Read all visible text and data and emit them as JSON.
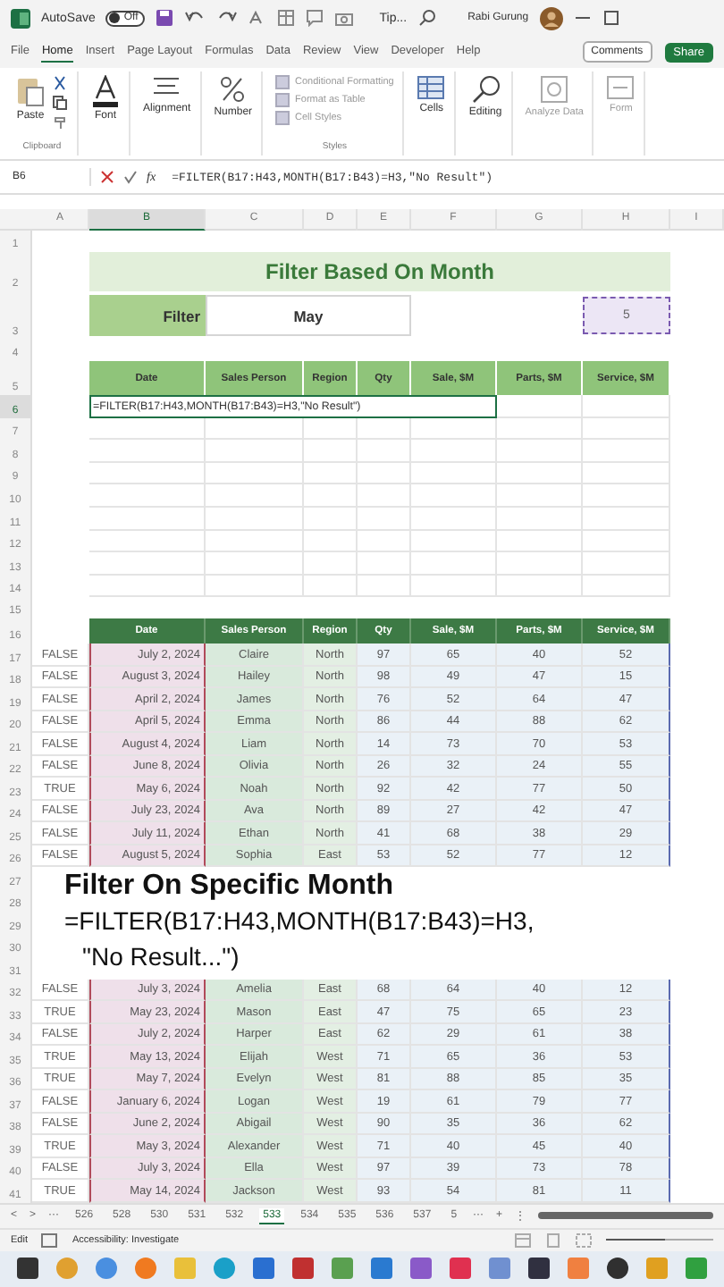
{
  "title_bar": {
    "autosave": "AutoSave",
    "autosave_state": "Off",
    "autosave_on": false,
    "document": "Tip...",
    "user": "Rabi Gurung"
  },
  "ribbon_tabs": [
    {
      "label": "File",
      "selected": false
    },
    {
      "label": "Home",
      "selected": true
    },
    {
      "label": "Insert",
      "selected": false
    },
    {
      "label": "Page Layout",
      "selected": false
    },
    {
      "label": "Formulas",
      "selected": false
    },
    {
      "label": "Data",
      "selected": false
    },
    {
      "label": "Review",
      "selected": false
    },
    {
      "label": "View",
      "selected": false
    },
    {
      "label": "Developer",
      "selected": false
    },
    {
      "label": "Help",
      "selected": false
    }
  ],
  "ribbon_buttons": {
    "comments": "Comments",
    "share": "Share"
  },
  "ribbon": {
    "paste": "Paste",
    "clipboard": "Clipboard",
    "font": "Font",
    "alignment": "Alignment",
    "number": "Number",
    "styles_items": [
      "Conditional Formatting",
      "Format as Table",
      "Cell Styles"
    ],
    "styles": "Styles",
    "cells": "Cells",
    "editing": "Editing",
    "analyze": "Analyze Data",
    "form": "Form"
  },
  "formula_bar": {
    "name_box": "B6",
    "fx": "fx",
    "formula": "=FILTER(B17:H43,MONTH(B17:B43)=H3,\"No Result\")"
  },
  "column_headers": [
    {
      "label": "A",
      "selected": false
    },
    {
      "label": "B",
      "selected": true
    },
    {
      "label": "C",
      "selected": false
    },
    {
      "label": "D",
      "selected": false
    },
    {
      "label": "E",
      "selected": false
    },
    {
      "label": "F",
      "selected": false
    },
    {
      "label": "G",
      "selected": false
    },
    {
      "label": "H",
      "selected": false
    },
    {
      "label": "I",
      "selected": false
    }
  ],
  "top_rows": [
    {
      "n": "1",
      "kind": "blank",
      "selected": false
    },
    {
      "n": "2",
      "kind": "title",
      "selected": false,
      "text": "Filter Based On Month"
    },
    {
      "n": "3",
      "kind": "filter",
      "selected": false,
      "label": "Filter",
      "value": "May",
      "month": "5"
    },
    {
      "n": "4",
      "kind": "blank",
      "selected": false
    },
    {
      "n": "5",
      "kind": "header",
      "selected": false,
      "cells": [
        "Date",
        "Sales Person",
        "Region",
        "Qty",
        "Sale, $M",
        "Parts, $M",
        "Service, $M"
      ]
    },
    {
      "n": "6",
      "kind": "editing",
      "selected": true,
      "text": "=FILTER(B17:H43,MONTH(B17:B43)=H3,\"No Result\")"
    },
    {
      "n": "7",
      "kind": "table_blank",
      "selected": false
    },
    {
      "n": "8",
      "kind": "table_blank",
      "selected": false
    },
    {
      "n": "9",
      "kind": "table_blank",
      "selected": false
    },
    {
      "n": "10",
      "kind": "table_blank",
      "selected": false
    },
    {
      "n": "11",
      "kind": "table_blank",
      "selected": false
    },
    {
      "n": "12",
      "kind": "table_blank",
      "selected": false
    },
    {
      "n": "13",
      "kind": "table_blank",
      "selected": false
    },
    {
      "n": "14",
      "kind": "table_blank",
      "selected": false
    },
    {
      "n": "15",
      "kind": "blank",
      "selected": false
    }
  ],
  "data_table": {
    "header": {
      "n": "16",
      "cells": [
        "Date",
        "Sales Person",
        "Region",
        "Qty",
        "Sale, $M",
        "Parts, $M",
        "Service, $M"
      ]
    },
    "rows": [
      {
        "n": "17",
        "cells": [
          "FALSE",
          "July 2, 2024",
          "Claire",
          "North",
          "97",
          "65",
          "40",
          "52"
        ]
      },
      {
        "n": "18",
        "cells": [
          "FALSE",
          "August 3, 2024",
          "Hailey",
          "North",
          "98",
          "49",
          "47",
          "15"
        ]
      },
      {
        "n": "19",
        "cells": [
          "FALSE",
          "April 2, 2024",
          "James",
          "North",
          "76",
          "52",
          "64",
          "47"
        ]
      },
      {
        "n": "20",
        "cells": [
          "FALSE",
          "April 5, 2024",
          "Emma",
          "North",
          "86",
          "44",
          "88",
          "62"
        ]
      },
      {
        "n": "21",
        "cells": [
          "FALSE",
          "August 4, 2024",
          "Liam",
          "North",
          "14",
          "73",
          "70",
          "53"
        ]
      },
      {
        "n": "22",
        "cells": [
          "FALSE",
          "June 8, 2024",
          "Olivia",
          "North",
          "26",
          "32",
          "24",
          "55"
        ]
      },
      {
        "n": "23",
        "cells": [
          "TRUE",
          "May 6, 2024",
          "Noah",
          "North",
          "92",
          "42",
          "77",
          "50"
        ]
      },
      {
        "n": "24",
        "cells": [
          "FALSE",
          "July 23, 2024",
          "Ava",
          "North",
          "89",
          "27",
          "42",
          "47"
        ]
      },
      {
        "n": "25",
        "cells": [
          "FALSE",
          "July 11, 2024",
          "Ethan",
          "North",
          "41",
          "68",
          "38",
          "29"
        ]
      },
      {
        "n": "26",
        "cells": [
          "FALSE",
          "August 5, 2024",
          "Sophia",
          "East",
          "53",
          "52",
          "77",
          "12"
        ]
      },
      {
        "n": "27"
      },
      {
        "n": "28"
      },
      {
        "n": "29"
      },
      {
        "n": "30"
      },
      {
        "n": "31"
      },
      {
        "n": "32",
        "cells": [
          "FALSE",
          "July 3, 2024",
          "Amelia",
          "East",
          "68",
          "64",
          "40",
          "12"
        ]
      },
      {
        "n": "33",
        "cells": [
          "TRUE",
          "May 23, 2024",
          "Mason",
          "East",
          "47",
          "75",
          "65",
          "23"
        ]
      },
      {
        "n": "34",
        "cells": [
          "FALSE",
          "July 2, 2024",
          "Harper",
          "East",
          "62",
          "29",
          "61",
          "38"
        ]
      },
      {
        "n": "35",
        "cells": [
          "TRUE",
          "May 13, 2024",
          "Elijah",
          "West",
          "71",
          "65",
          "36",
          "53"
        ]
      },
      {
        "n": "36",
        "cells": [
          "TRUE",
          "May 7, 2024",
          "Evelyn",
          "West",
          "81",
          "88",
          "85",
          "35"
        ]
      },
      {
        "n": "37",
        "cells": [
          "FALSE",
          "January 6, 2024",
          "Logan",
          "West",
          "19",
          "61",
          "79",
          "77"
        ]
      },
      {
        "n": "38",
        "cells": [
          "FALSE",
          "June 2, 2024",
          "Abigail",
          "West",
          "90",
          "35",
          "36",
          "62"
        ]
      },
      {
        "n": "39",
        "cells": [
          "TRUE",
          "May 3, 2024",
          "Alexander",
          "West",
          "71",
          "40",
          "45",
          "40"
        ]
      },
      {
        "n": "40",
        "cells": [
          "FALSE",
          "July 3, 2024",
          "Ella",
          "West",
          "97",
          "39",
          "73",
          "78"
        ]
      },
      {
        "n": "41",
        "cells": [
          "TRUE",
          "May 14, 2024",
          "Jackson",
          "West",
          "93",
          "54",
          "81",
          "11"
        ]
      }
    ]
  },
  "caption": {
    "title": "Filter On Specific Month",
    "lines": [
      "=FILTER(B17:H43,MONTH(B17:B43)=H3,",
      "\"No Result...\")"
    ]
  },
  "sheet_tabs": [
    {
      "label": "526",
      "selected": false
    },
    {
      "label": "528",
      "selected": false
    },
    {
      "label": "530",
      "selected": false
    },
    {
      "label": "531",
      "selected": false
    },
    {
      "label": "532",
      "selected": false
    },
    {
      "label": "533",
      "selected": true
    },
    {
      "label": "534",
      "selected": false
    },
    {
      "label": "535",
      "selected": false
    },
    {
      "label": "536",
      "selected": false
    },
    {
      "label": "537",
      "selected": false
    },
    {
      "label": "5",
      "selected": false
    }
  ],
  "sheet_nav": {
    "prev": "<",
    "next": ">",
    "more": "···",
    "more_right": "···",
    "add": "+",
    "menu": "⋮"
  },
  "status_bar": {
    "mode": "Edit",
    "accessibility": "Accessibility: Investigate",
    "zoom": {
      "level": 0.55
    }
  }
}
